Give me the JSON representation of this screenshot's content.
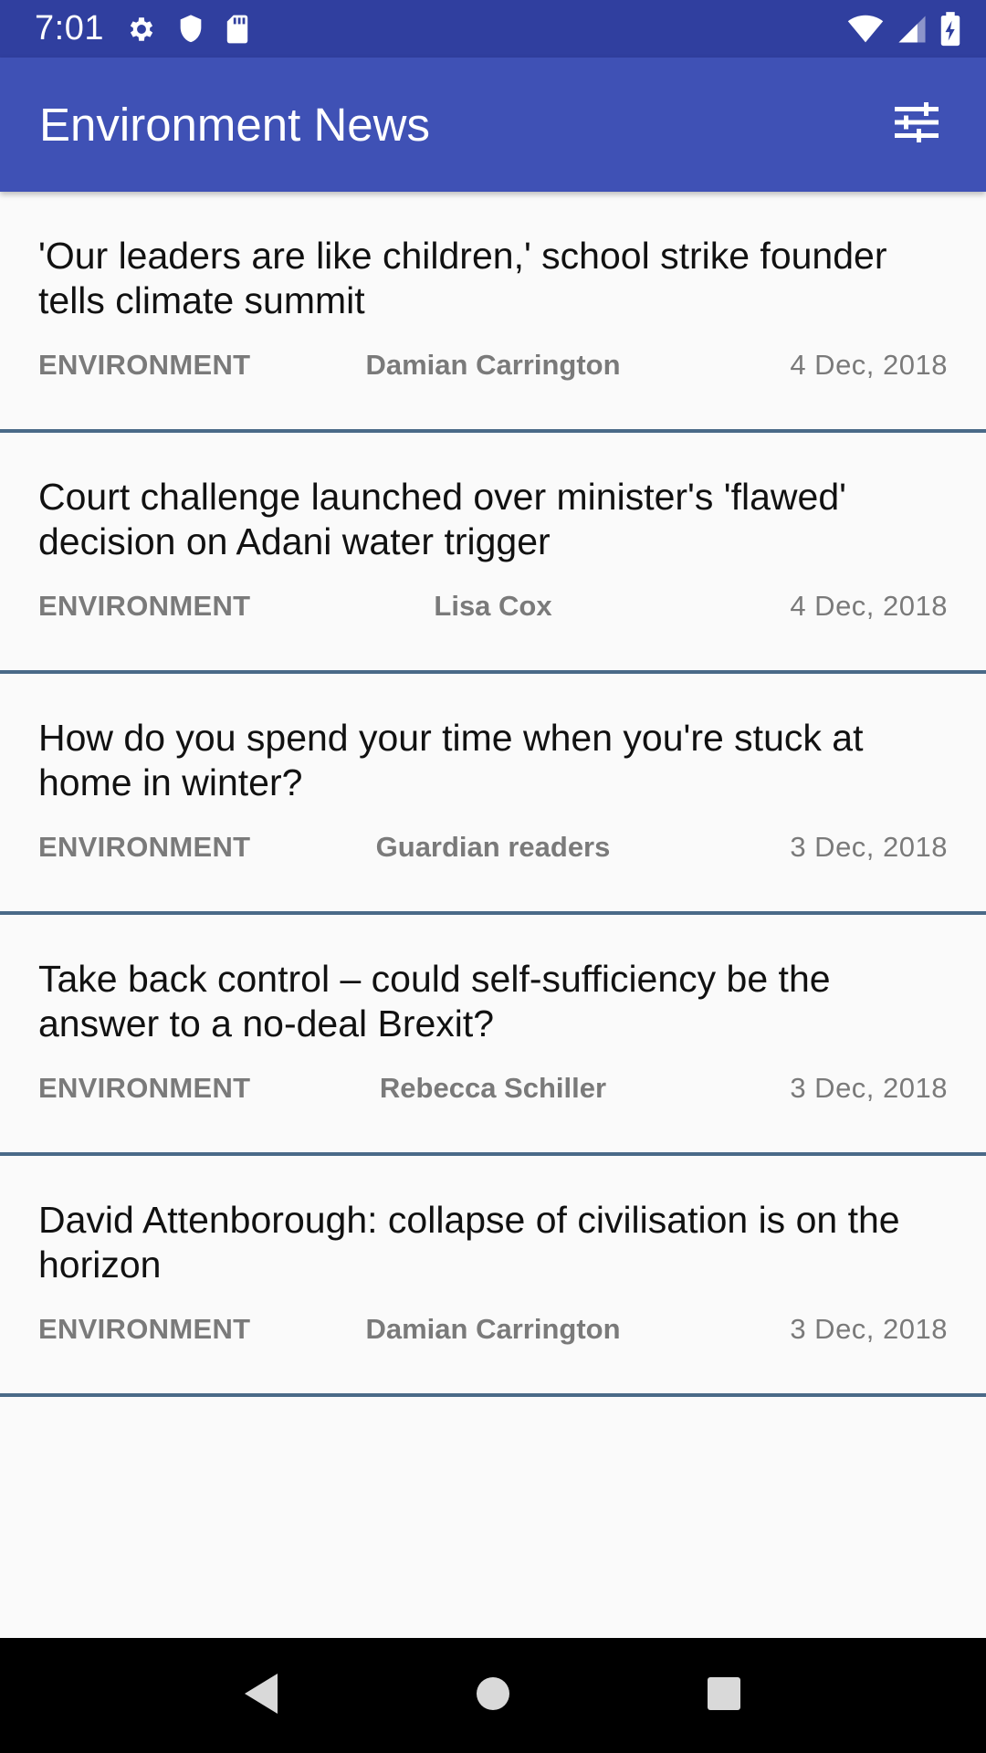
{
  "status_bar": {
    "time": "7:01",
    "left_icons": [
      "gear-icon",
      "shield-icon",
      "sd-card-icon"
    ],
    "right_icons": [
      "wifi-icon",
      "cell-signal-icon",
      "battery-charging-icon"
    ]
  },
  "app_bar": {
    "title": "Environment News",
    "action_icon": "filter-settings-icon",
    "color": "#3f51b5",
    "status_color": "#303f9f"
  },
  "articles": [
    {
      "headline": "'Our leaders are like children,' school strike founder tells climate summit",
      "section": "ENVIRONMENT",
      "author": "Damian Carrington",
      "date": "4 Dec, 2018"
    },
    {
      "headline": "Court challenge launched over minister's 'flawed' decision on Adani water trigger",
      "section": "ENVIRONMENT",
      "author": "Lisa Cox",
      "date": "4 Dec, 2018"
    },
    {
      "headline": "How do you spend your time when you're stuck at home in winter?",
      "section": "ENVIRONMENT",
      "author": "Guardian readers",
      "date": "3 Dec, 2018"
    },
    {
      "headline": "Take back control – could self-sufficiency be the answer to a no-deal Brexit?",
      "section": "ENVIRONMENT",
      "author": "Rebecca Schiller",
      "date": "3 Dec, 2018"
    },
    {
      "headline": "David Attenborough: collapse of civilisation is on the horizon",
      "section": "ENVIRONMENT",
      "author": "Damian Carrington",
      "date": "3 Dec, 2018"
    }
  ],
  "nav_bar": {
    "buttons": [
      "back-icon",
      "home-icon",
      "recents-icon"
    ]
  }
}
